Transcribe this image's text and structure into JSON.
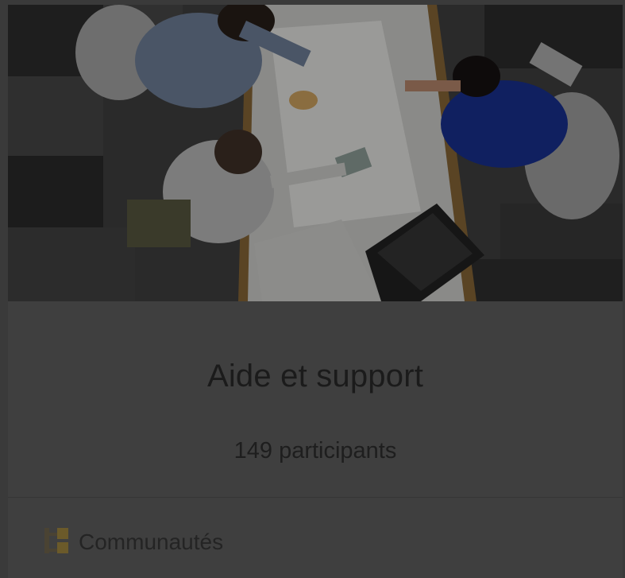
{
  "card": {
    "title": "Aide et support",
    "members": "149 participants",
    "footer_label": "Communautés",
    "footer_icon": "communities-icon",
    "image": "meeting-photo"
  },
  "colors": {
    "background": "#3a3a3a",
    "card": "#3f3f3f",
    "title": "#1b1b1b",
    "icon_accent": "#6b5a2a"
  }
}
